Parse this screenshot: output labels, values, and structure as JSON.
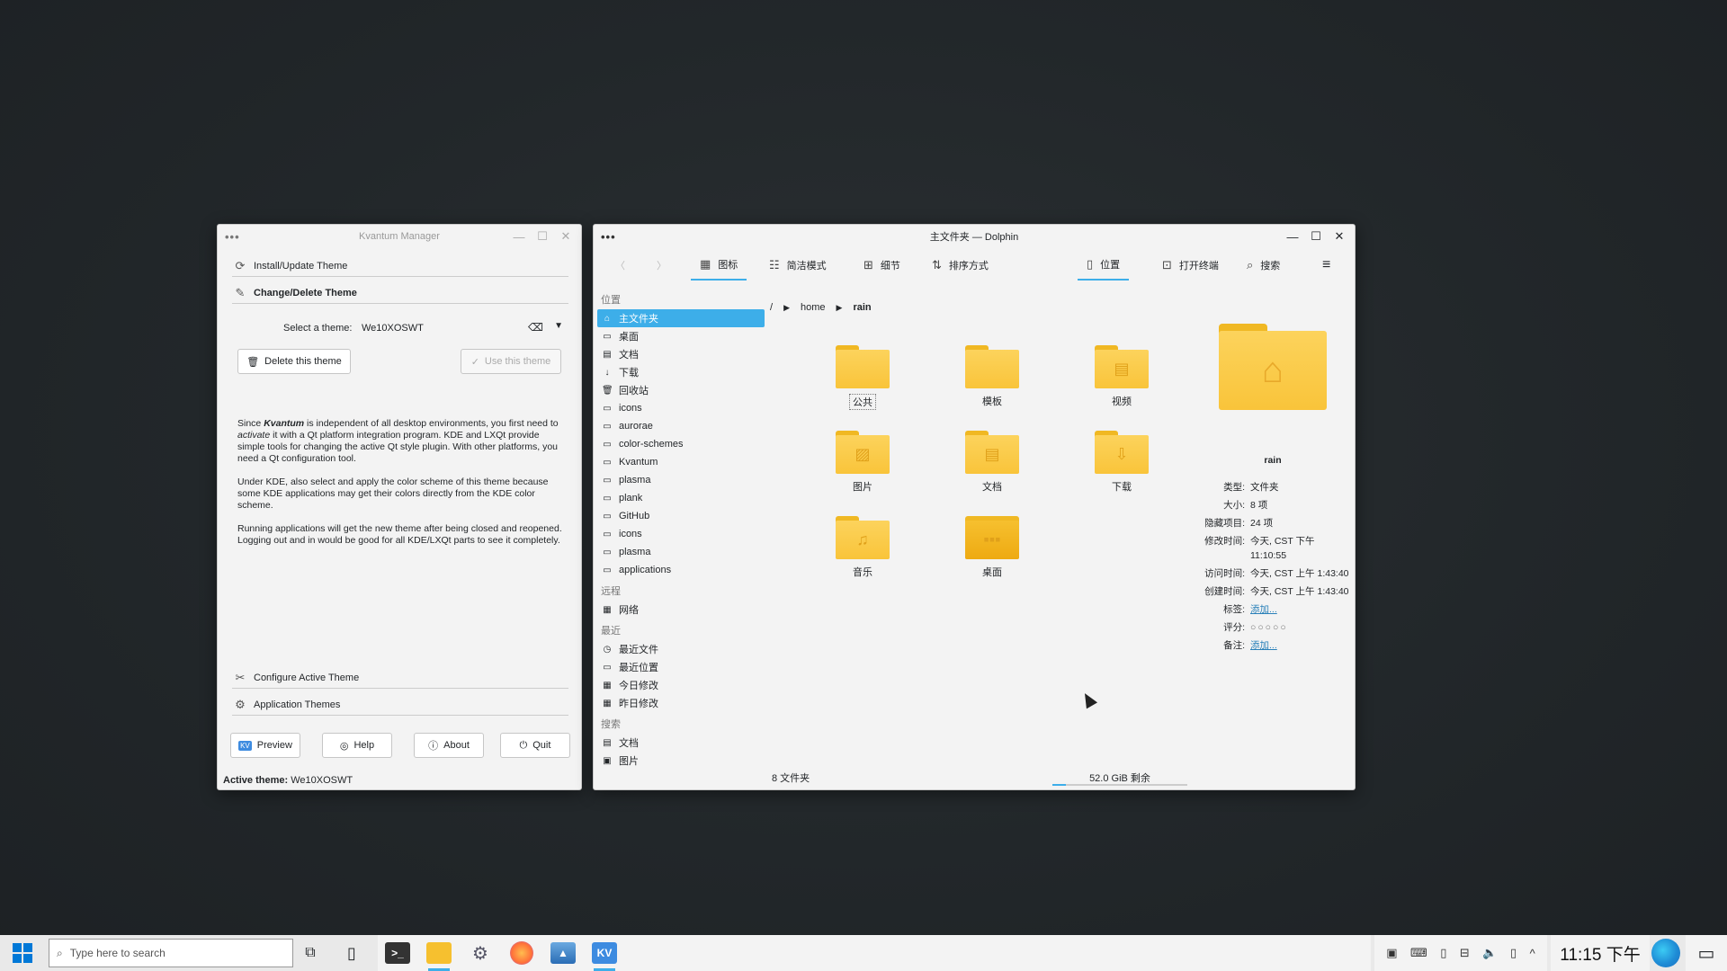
{
  "kvantum": {
    "title": "Kvantum Manager",
    "sections": {
      "install": "Install/Update Theme",
      "change": "Change/Delete Theme",
      "configure": "Configure Active Theme",
      "app_themes": "Application Themes"
    },
    "select_label": "Select a theme:",
    "theme_value": "We10XOSWT",
    "delete_btn": "Delete this theme",
    "use_btn": "Use this theme",
    "para1_a": "Since ",
    "para1_kvantum": "Kvantum",
    "para1_b": " is independent of all desktop environments, you first need to ",
    "para1_activate": "activate",
    "para1_c": " it with a Qt platform integration program. KDE and LXQt provide simple tools for changing the active Qt style plugin. With other platforms, you need a Qt configuration tool.",
    "para2": "Under KDE, also select and apply the color scheme of this theme because some KDE applications may get their colors directly from the KDE color scheme.",
    "para3": "Running applications will get the new theme after being closed and reopened. Logging out and in would be good for all KDE/LXQt parts to see it completely.",
    "buttons": {
      "preview": "Preview",
      "help": "Help",
      "about": "About",
      "quit": "Quit"
    },
    "status_label": "Active theme:",
    "status_value": "We10XOSWT"
  },
  "dolphin": {
    "title": "主文件夹 — Dolphin",
    "toolbar": {
      "icons": "图标",
      "compact": "简洁模式",
      "details": "细节",
      "sort": "排序方式",
      "places": "位置",
      "terminal": "打开终端",
      "search": "搜索"
    },
    "places": {
      "group_places": "位置",
      "items": [
        "主文件夹",
        "桌面",
        "文档",
        "下载",
        "回收站",
        "icons",
        "aurorae",
        "color-schemes",
        "Kvantum",
        "plasma",
        "plank",
        "GitHub",
        "icons",
        "plasma",
        "applications"
      ],
      "group_remote": "远程",
      "remote_items": [
        "网络"
      ],
      "group_recent": "最近",
      "recent_items": [
        "最近文件",
        "最近位置",
        "今日修改",
        "昨日修改"
      ],
      "group_search": "搜索",
      "search_items": [
        "文档",
        "图片"
      ]
    },
    "breadcrumb": [
      "/",
      "home",
      "rain"
    ],
    "folders": [
      "公共",
      "模板",
      "视频",
      "图片",
      "文档",
      "下载",
      "音乐",
      "桌面"
    ],
    "info": {
      "name": "rain",
      "type_k": "类型:",
      "type_v": "文件夹",
      "size_k": "大小:",
      "size_v": "8 项",
      "hidden_k": "隐藏项目:",
      "hidden_v": "24 项",
      "modified_k": "修改时间:",
      "modified_v": "今天, CST 下午 11:10:55",
      "accessed_k": "访问时间:",
      "accessed_v": "今天, CST 上午 1:43:40",
      "created_k": "创建时间:",
      "created_v": "今天, CST 上午 1:43:40",
      "tags_k": "标签:",
      "tags_v": "添加...",
      "rating_k": "评分:",
      "rating_v": "○○○○○",
      "comment_k": "备注:",
      "comment_v": "添加..."
    },
    "status_count": "8 文件夹",
    "status_free": "52.0 GiB 剩余",
    "free_fill_fraction": 0.1
  },
  "taskbar": {
    "search_placeholder": "Type here to search",
    "clock": "11:15 下午",
    "kv_label": "KV"
  }
}
